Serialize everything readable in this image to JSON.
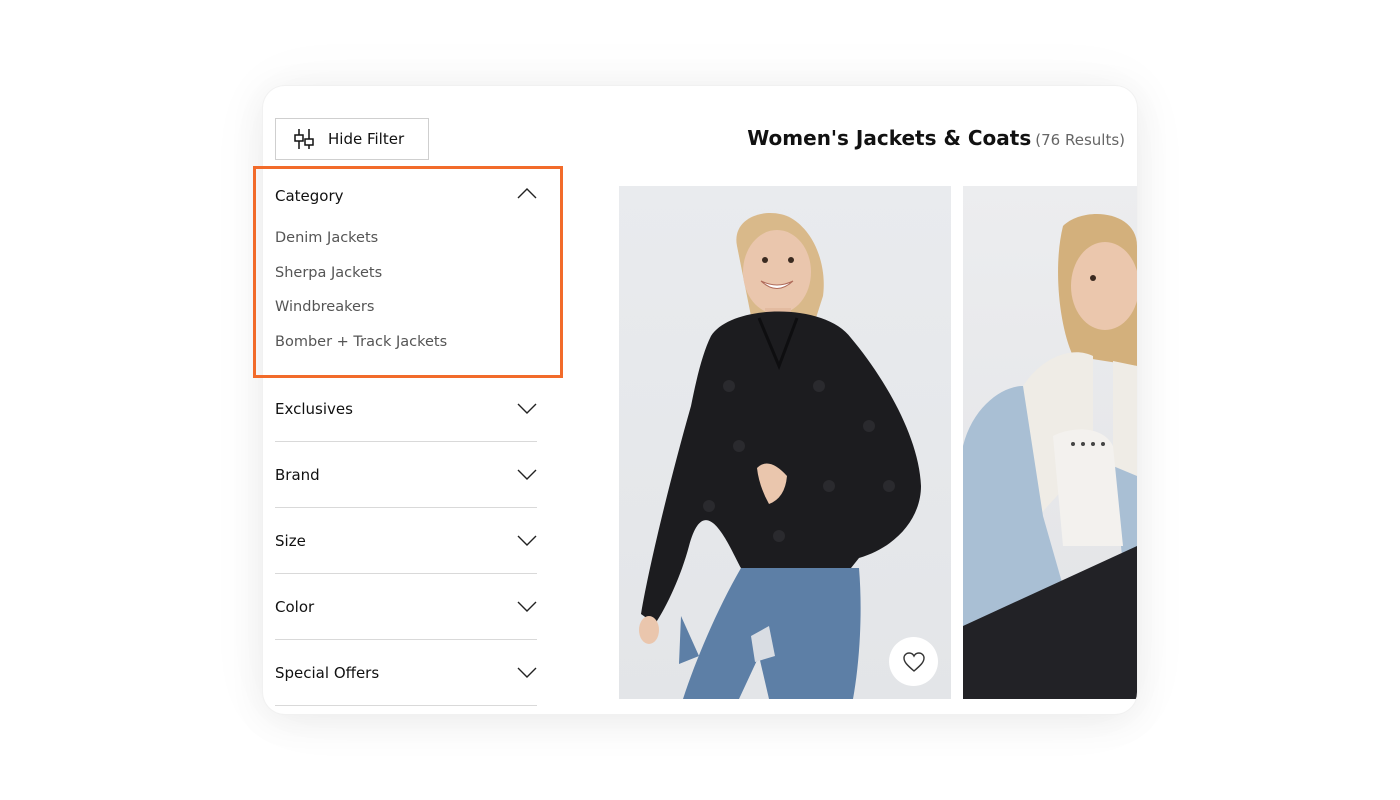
{
  "toolbar": {
    "hide_filter_label": "Hide Filter"
  },
  "header": {
    "title": "Women's Jackets & Coats",
    "result_count": "(76 Results)"
  },
  "filters": {
    "category": {
      "label": "Category",
      "expanded": true,
      "items": [
        "Denim Jackets",
        "Sherpa Jackets",
        "Windbreakers",
        "Bomber + Track Jackets"
      ]
    },
    "sections": [
      {
        "label": "Exclusives"
      },
      {
        "label": "Brand"
      },
      {
        "label": "Size"
      },
      {
        "label": "Color"
      },
      {
        "label": "Special Offers"
      }
    ]
  },
  "products": [
    {
      "image": "woman in black sherpa jacket and ripped jeans",
      "action_icon": "heart-icon"
    },
    {
      "image": "woman in light denim sherpa-lined jacket"
    }
  ],
  "colors": {
    "highlight": "#f26b2a",
    "text": "#111111",
    "muted": "#555555",
    "divider": "#d9d9d9"
  }
}
